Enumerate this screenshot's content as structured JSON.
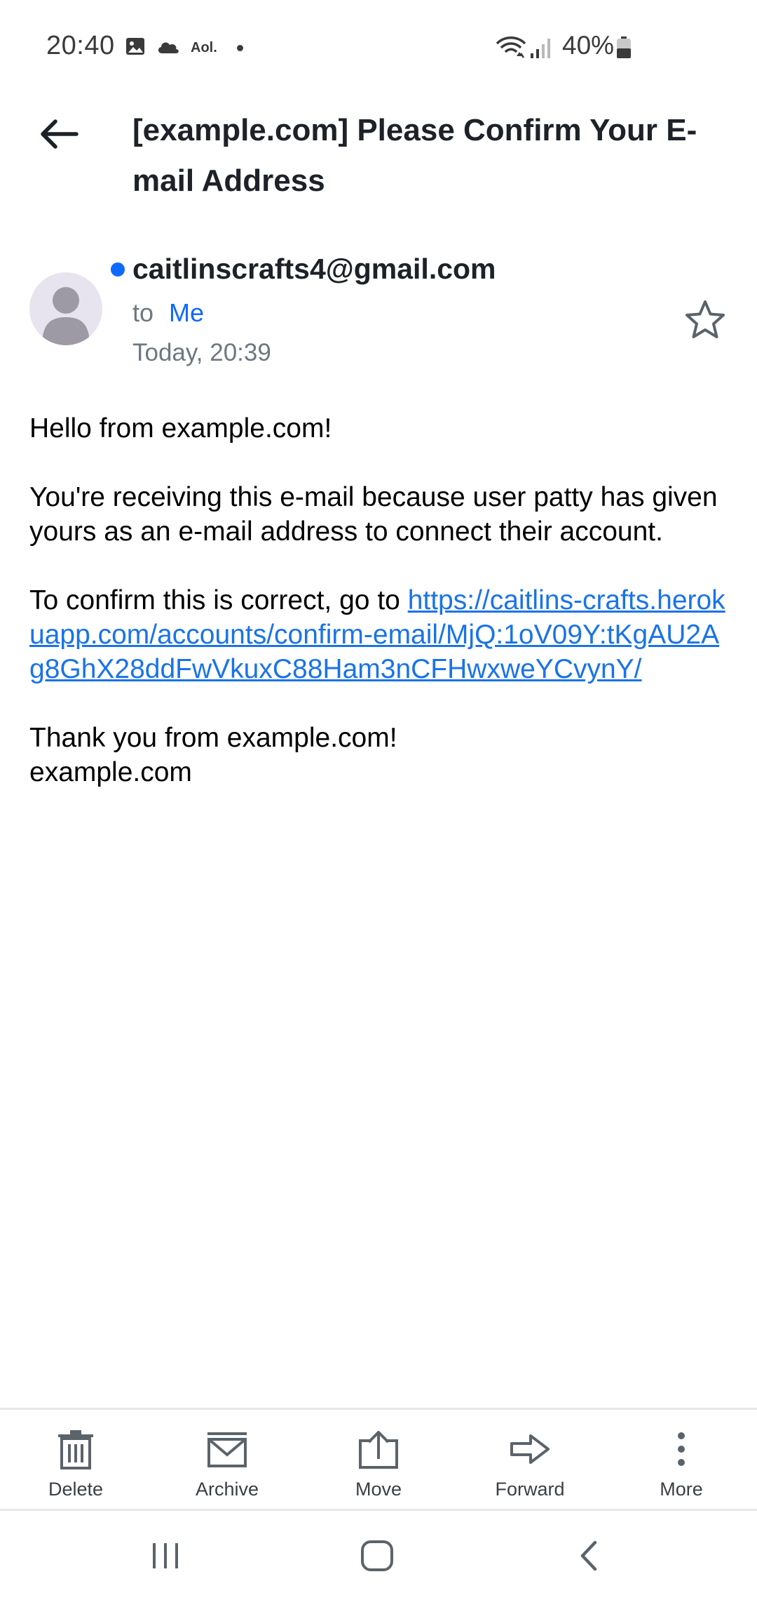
{
  "status_bar": {
    "time": "20:40",
    "carrier_badge": "Aol.",
    "battery_pct": "40%",
    "icons": [
      "image-icon",
      "cloud-icon",
      "dot-icon",
      "wifi-icon",
      "signal-icon",
      "battery-icon"
    ]
  },
  "header": {
    "back_icon": "arrow-left-icon",
    "subject": "[example.com] Please Confirm Your E-mail Address"
  },
  "sender": {
    "email": "caitlinscrafts4@gmail.com",
    "to_label": "to",
    "to_value": "Me",
    "date": "Today, 20:39",
    "star_icon": "star-outline-icon",
    "unread_color": "#0f69ff"
  },
  "body": {
    "greeting": "Hello from example.com!",
    "paragraph": "You're receiving this e-mail because user patty has given yours as an e-mail address to connect their account.",
    "confirm_prefix": "To confirm this is correct, go to ",
    "confirm_link": "https://caitlins-crafts.herokuapp.com/accounts/confirm-email/MjQ:1oV09Y:tKgAU2Ag8GhX28ddFwVkuxC88Ham3nCFHwxweYCvynY/",
    "thanks": "Thank you from example.com!",
    "signature": "example.com"
  },
  "toolbar": {
    "items": [
      {
        "label": "Delete",
        "icon": "trash-icon"
      },
      {
        "label": "Archive",
        "icon": "archive-icon"
      },
      {
        "label": "Move",
        "icon": "move-icon"
      },
      {
        "label": "Forward",
        "icon": "forward-icon"
      },
      {
        "label": "More",
        "icon": "more-vertical-icon"
      }
    ]
  },
  "navbar": {
    "icons": [
      "recent-apps-icon",
      "home-icon",
      "back-nav-icon"
    ]
  },
  "colors": {
    "accent": "#0f69ff",
    "link": "#1a73e8",
    "text": "#1d2228",
    "muted": "#6e7780"
  }
}
